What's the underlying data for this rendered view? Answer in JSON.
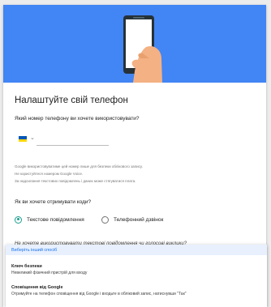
{
  "page": {
    "title": "Налаштуйте свій телефон",
    "phone_question": "Який номер телефону ви хочете використовувати?",
    "country_flag": "ukraine-flag",
    "phone_value": "",
    "info_lines": [
      "Google використовуватиме цей номер лише для безпеки облікового запису.",
      "Не користуйтеся номером Google Voice.",
      "За надсилання текстових повідомлень і даних може стягуватися плата."
    ],
    "code_question": "Як ви хочете отримувати коди?",
    "options": [
      {
        "label": "Текстове повідомлення",
        "selected": true
      },
      {
        "label": "Телефонний дзвінок",
        "selected": false
      }
    ],
    "no_use_text": "Не хочете використовувати текстові повідомлення чи голосові виклики?"
  },
  "dropdown": {
    "header": "Виберіть інший спосіб",
    "items": [
      {
        "title": "Ключ безпеки",
        "desc": "Невеликий фізичний пристрій для входу"
      },
      {
        "title": "Сповіщення від Google",
        "desc": "Отримуйте на телефон сповіщення від Google і входьте в обліковий запис, натиснувши \"Так\""
      }
    ]
  },
  "colors": {
    "hero": "#4285f4",
    "accent": "#1a9e8f",
    "link": "#1a73e8"
  }
}
